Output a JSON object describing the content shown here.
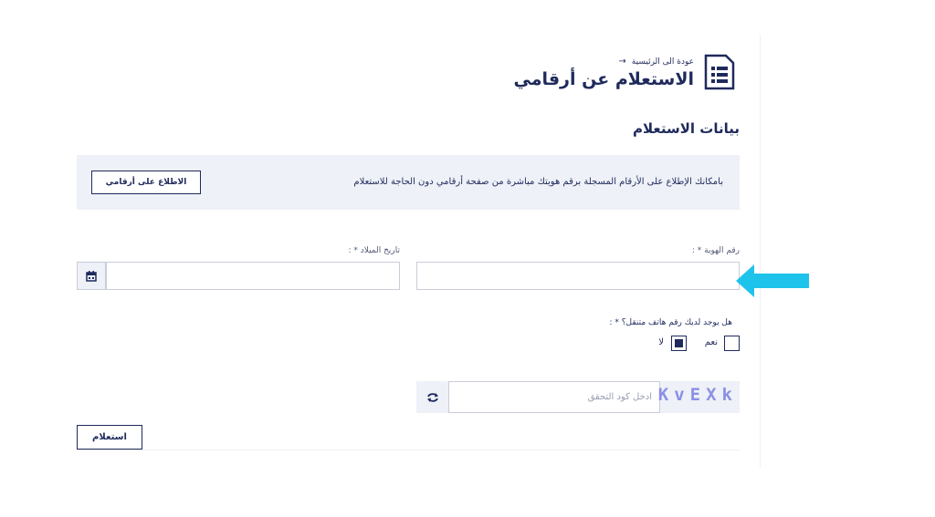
{
  "header": {
    "back_label": "عودة الى الرئيسية",
    "title": "الاستعلام عن أرقامي",
    "logo_icon": "document-id-icon"
  },
  "section": {
    "title": "بيانات الاستعلام"
  },
  "info": {
    "text": "بامكانك الإطلاع على الأرقام المسجلة برقم هويتك مباشرة من صفحة أرقامي دون الحاجة للاستعلام",
    "button_label": "الاطلاع على أرقامي"
  },
  "form": {
    "id_label": "رقم الهوية * :",
    "id_value": "",
    "dob_label": "تاريخ الميلاد * :",
    "dob_value": "",
    "mobile_question": "هل يوجد لديك رقم هاتف متنقل؟ * :",
    "options": {
      "yes_label": "نعم",
      "no_label": "لا",
      "selected": "لا"
    },
    "captcha_placeholder": "ادخل كود التحقق",
    "captcha_code": "KvEXk",
    "submit_label": "استعلام"
  },
  "colors": {
    "primary": "#1f2a5c",
    "panel_bg": "#eef1f7",
    "indicator_arrow": "#1ec3ec",
    "captcha_text": "#8a90e6"
  }
}
